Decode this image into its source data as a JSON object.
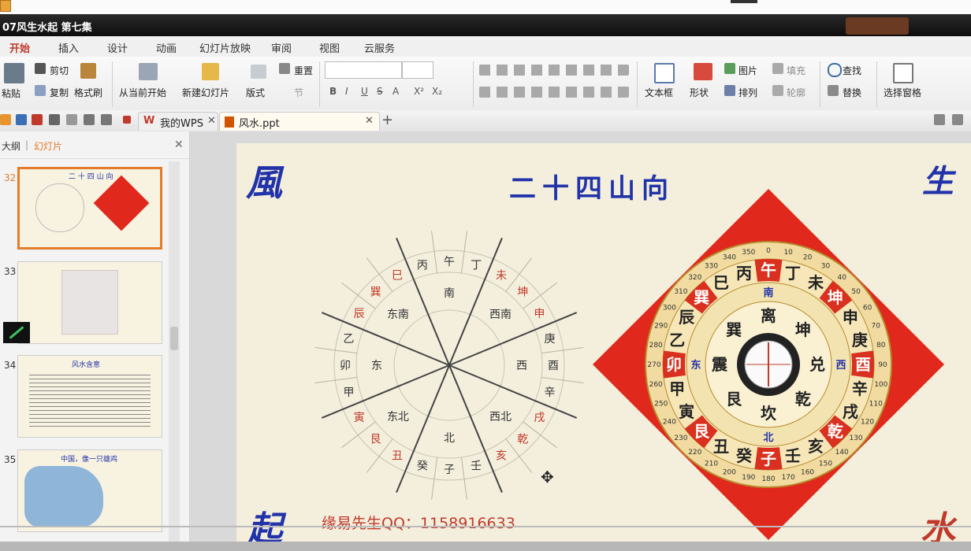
{
  "window": {
    "title": "07风生水起 第七集"
  },
  "ribbon_tabs": [
    "开始",
    "插入",
    "设计",
    "动画",
    "幻灯片放映",
    "审阅",
    "视图",
    "云服务"
  ],
  "ribbon": {
    "paste": "粘贴",
    "cut": "剪切",
    "copy": "复制",
    "format_painter": "格式刷",
    "from_current": "从当前开始",
    "new_slide": "新建幻灯片",
    "layout": "版式",
    "reset": "重置",
    "section": "节",
    "textbox": "文本框",
    "shape": "形状",
    "picture": "图片",
    "fill": "填充",
    "arrange": "排列",
    "outline": "轮廓",
    "find": "查找",
    "replace": "替换",
    "selection_pane": "选择窗格",
    "font_buttons": [
      "B",
      "I",
      "U",
      "S",
      "A",
      "X²",
      "X₂"
    ]
  },
  "doc_tabs": [
    {
      "label": "我的WPS",
      "icon": "wps-icon"
    },
    {
      "label": "风水.ppt",
      "icon": "ppt-file-icon"
    }
  ],
  "left_panel": {
    "tab_outline": "大纲",
    "tab_slides": "幻灯片",
    "divider": "|",
    "slides": [
      {
        "num": "32",
        "title": "二 十 四 山 向"
      },
      {
        "num": "33",
        "title": ""
      },
      {
        "num": "34",
        "title": "风水含意"
      },
      {
        "num": "35",
        "title": "中国，像一只雄鸡"
      }
    ]
  },
  "slide": {
    "title": "二十四山向",
    "corner_tl": "風",
    "corner_tr": "生",
    "corner_bl": "起",
    "corner_br": "水",
    "footer": "缘易先生QQ：1158916633",
    "wheel": {
      "outer_labels": [
        "丙",
        "午",
        "丁",
        "未",
        "坤",
        "申",
        "庚",
        "酉",
        "辛",
        "戌",
        "乾",
        "亥",
        "壬",
        "子",
        "癸",
        "丑",
        "艮",
        "寅",
        "甲",
        "卯",
        "乙",
        "辰",
        "巽",
        "巳"
      ],
      "inner_labels": [
        "南",
        "西南",
        "西",
        "西北",
        "北",
        "东北",
        "东",
        "东南"
      ]
    },
    "compass": {
      "ring_labels": [
        "午",
        "丁",
        "未",
        "坤",
        "申",
        "庚",
        "酉",
        "辛",
        "戌",
        "乾",
        "亥",
        "壬",
        "子",
        "癸",
        "丑",
        "艮",
        "寅",
        "甲",
        "卯",
        "乙",
        "辰",
        "巽",
        "巳",
        "丙"
      ],
      "trigrams": [
        "离",
        "坤",
        "兑",
        "乾",
        "坎",
        "艮",
        "震",
        "巽"
      ],
      "directions": [
        "南",
        "西",
        "北",
        "东"
      ],
      "degrees": [
        "0",
        "10",
        "20",
        "30",
        "40",
        "50",
        "60",
        "70",
        "80",
        "90",
        "100",
        "110",
        "120",
        "130",
        "140",
        "150",
        "160",
        "170",
        "180",
        "190",
        "200",
        "210",
        "220",
        "230",
        "240",
        "250",
        "260",
        "270",
        "280",
        "290",
        "300",
        "310",
        "320",
        "330",
        "340",
        "350"
      ]
    }
  },
  "colors": {
    "accent": "#c0392b",
    "title_bar": "#111111",
    "slide_bg": "#f3efdc",
    "compass_red": "#e0281c",
    "callig_blue": "#2233aa"
  }
}
